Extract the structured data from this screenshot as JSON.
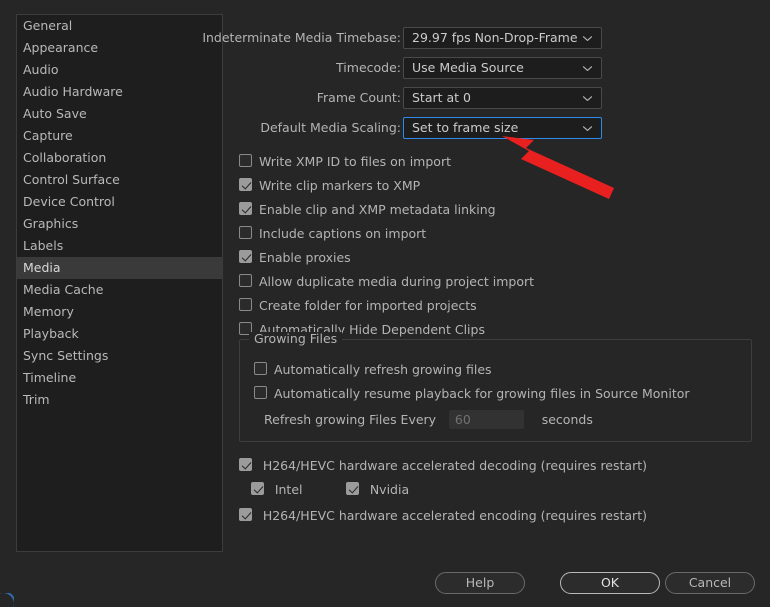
{
  "sidebar": {
    "items": [
      {
        "label": "General",
        "selected": false
      },
      {
        "label": "Appearance",
        "selected": false
      },
      {
        "label": "Audio",
        "selected": false
      },
      {
        "label": "Audio Hardware",
        "selected": false
      },
      {
        "label": "Auto Save",
        "selected": false
      },
      {
        "label": "Capture",
        "selected": false
      },
      {
        "label": "Collaboration",
        "selected": false
      },
      {
        "label": "Control Surface",
        "selected": false
      },
      {
        "label": "Device Control",
        "selected": false
      },
      {
        "label": "Graphics",
        "selected": false
      },
      {
        "label": "Labels",
        "selected": false
      },
      {
        "label": "Media",
        "selected": true
      },
      {
        "label": "Media Cache",
        "selected": false
      },
      {
        "label": "Memory",
        "selected": false
      },
      {
        "label": "Playback",
        "selected": false
      },
      {
        "label": "Sync Settings",
        "selected": false
      },
      {
        "label": "Timeline",
        "selected": false
      },
      {
        "label": "Trim",
        "selected": false
      }
    ]
  },
  "main": {
    "dropdowns": [
      {
        "label": "Indeterminate Media Timebase:",
        "value": "29.97 fps Non-Drop-Frame",
        "icon": "chevron-down-icon",
        "focused": false,
        "name": "indeterminate-media-timebase"
      },
      {
        "label": "Timecode:",
        "value": "Use Media Source",
        "icon": "chevron-down-icon",
        "focused": false,
        "name": "timecode"
      },
      {
        "label": "Frame Count:",
        "value": "Start at 0",
        "icon": "chevron-down-icon",
        "focused": false,
        "name": "frame-count"
      },
      {
        "label": "Default Media Scaling:",
        "value": "Set to frame size",
        "icon": "chevron-down-icon",
        "focused": true,
        "name": "default-media-scaling"
      }
    ],
    "checkboxes": [
      {
        "label": "Write XMP ID to files on import",
        "checked": false,
        "name": "write-xmp-id-to-files-on-import"
      },
      {
        "label": "Write clip markers to XMP",
        "checked": true,
        "name": "write-clip-markers-to-xmp"
      },
      {
        "label": "Enable clip and XMP metadata linking",
        "checked": true,
        "name": "enable-clip-and-xmp-metadata-linking"
      },
      {
        "label": "Include captions on import",
        "checked": false,
        "name": "include-captions-on-import"
      },
      {
        "label": "Enable proxies",
        "checked": true,
        "name": "enable-proxies"
      },
      {
        "label": "Allow duplicate media during project import",
        "checked": false,
        "name": "allow-duplicate-media-during-project-import"
      },
      {
        "label": "Create folder for imported projects",
        "checked": false,
        "name": "create-folder-for-imported-projects"
      },
      {
        "label": "Automatically Hide Dependent Clips",
        "checked": false,
        "name": "automatically-hide-dependent-clips"
      }
    ],
    "growing_files": {
      "legend": "Growing Files",
      "checkboxes": [
        {
          "label": "Automatically refresh growing files",
          "checked": false,
          "name": "automatically-refresh-growing-files"
        },
        {
          "label": "Automatically resume playback for growing files in Source Monitor",
          "checked": false,
          "name": "automatically-resume-playback-growing-files"
        }
      ],
      "refresh_label": "Refresh growing Files Every",
      "refresh_value": "60",
      "refresh_unit": "seconds"
    },
    "hardware": {
      "decoding": {
        "label": "H264/HEVC hardware accelerated decoding (requires restart)",
        "checked": true,
        "name": "h264-hevc-hardware-accelerated-decoding"
      },
      "vendors": [
        {
          "label": "Intel",
          "checked": true,
          "name": "intel"
        },
        {
          "label": "Nvidia",
          "checked": true,
          "name": "nvidia"
        }
      ],
      "encoding": {
        "label": "H264/HEVC hardware accelerated encoding (requires restart)",
        "checked": true,
        "name": "h264-hevc-hardware-accelerated-encoding"
      }
    }
  },
  "footer": {
    "help": "Help",
    "ok": "OK",
    "cancel": "Cancel"
  },
  "annotation": {
    "type": "red-arrow",
    "points_to": "default-media-scaling-dropdown",
    "color": "#e8201f"
  },
  "colors": {
    "window_background": "#262626",
    "panel_background": "#1e1e1e",
    "selected_row": "#3a3a3a",
    "focus_border": "#2d8ceb",
    "text": "#b4b4b4",
    "annotation_red": "#e8201f"
  }
}
